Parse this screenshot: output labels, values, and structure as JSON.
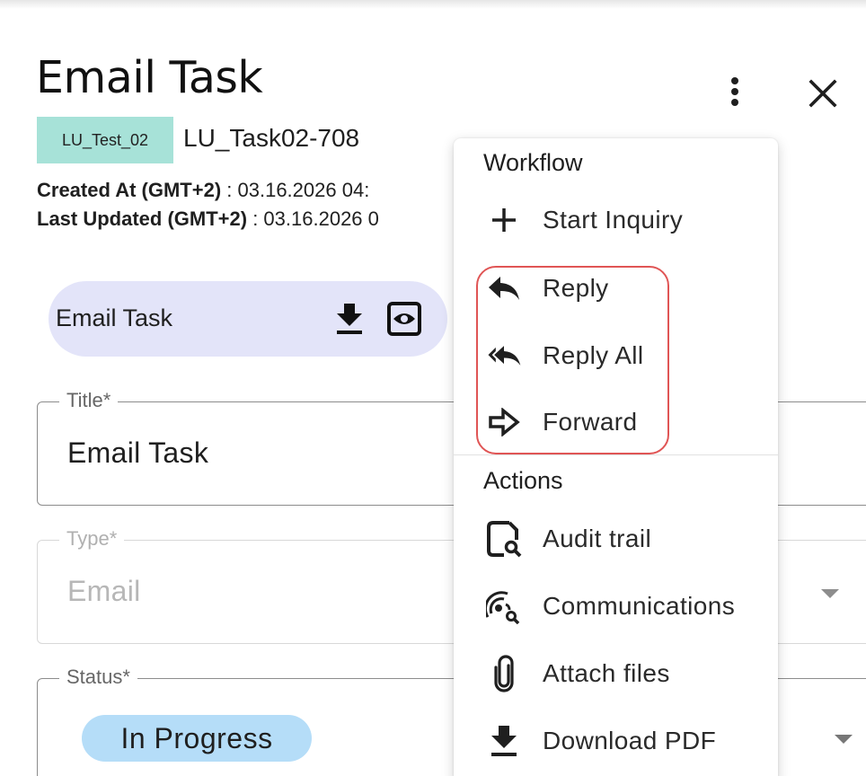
{
  "header": {
    "title": "Email Task",
    "more_icon": "more-vertical-icon",
    "close_icon": "close-icon"
  },
  "task": {
    "tag": "LU_Test_02",
    "tag_color": "#a7e2d8",
    "id": "LU_Task02-708",
    "created_label": "Created At (GMT+2)",
    "created_value": ": 03.16.2026 04:",
    "updated_label": "Last Updated (GMT+2)",
    "updated_value": ": 03.16.2026 0"
  },
  "document": {
    "name": "Email Task",
    "download_icon": "download-icon",
    "preview_icon": "preview-eye-icon",
    "pill_color": "#e3e4f9"
  },
  "form": {
    "title_label": "Title*",
    "title_value": "Email Task",
    "type_label": "Type*",
    "type_value": "Email",
    "status_label": "Status*",
    "status_value": "In Progress",
    "status_chip_color": "#b5ddf8"
  },
  "menu": {
    "workflow_heading": "Workflow",
    "actions_heading": "Actions",
    "workflow_items": [
      {
        "label": "Start Inquiry",
        "icon": "plus-icon"
      },
      {
        "label": "Reply",
        "icon": "reply-icon"
      },
      {
        "label": "Reply All",
        "icon": "reply-all-icon"
      },
      {
        "label": "Forward",
        "icon": "forward-icon"
      }
    ],
    "action_items": [
      {
        "label": "Audit trail",
        "icon": "audit-trail-icon"
      },
      {
        "label": "Communications",
        "icon": "communications-icon"
      },
      {
        "label": "Attach files",
        "icon": "attach-icon"
      },
      {
        "label": "Download PDF",
        "icon": "download-pdf-icon"
      }
    ],
    "highlight_color": "#e05555"
  }
}
